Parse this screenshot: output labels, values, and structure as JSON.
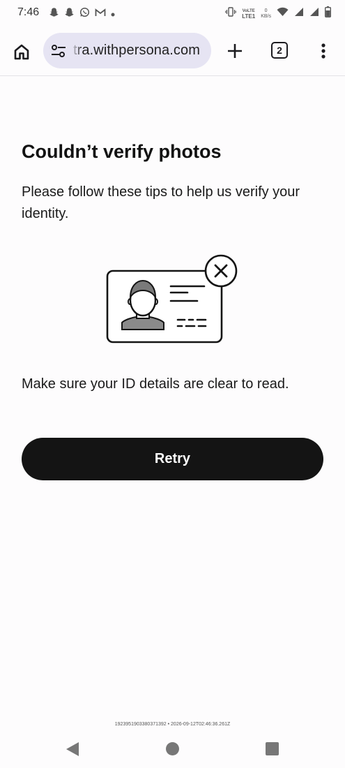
{
  "status_bar": {
    "time": "7:46",
    "left_icons": [
      "snapchat-icon",
      "snapchat-icon",
      "whatsapp-icon",
      "gmail-icon",
      "dot-icon"
    ],
    "volte_line1": "VoLTE",
    "volte_line2": "LTE1",
    "data_rate_value": "0",
    "data_rate_unit": "KB/s",
    "right_icons": [
      "vibrate-icon",
      "wifi-icon",
      "signal-icon",
      "signal-icon",
      "battery-icon"
    ]
  },
  "browser": {
    "url": "tra.withpersona.com",
    "tab_count": "2"
  },
  "page": {
    "title": "Couldn’t verify photos",
    "subtitle": "Please follow these tips to help us verify your identity.",
    "tip": "Make sure your ID details are clear to read.",
    "retry_label": "Retry",
    "footer_id": "1923951903380371392 • 2026-09-12T02:46:36.261Z"
  },
  "colors": {
    "primary_button": "#141414",
    "url_bar": "#e6e4f3",
    "background": "#fdfcfd"
  }
}
